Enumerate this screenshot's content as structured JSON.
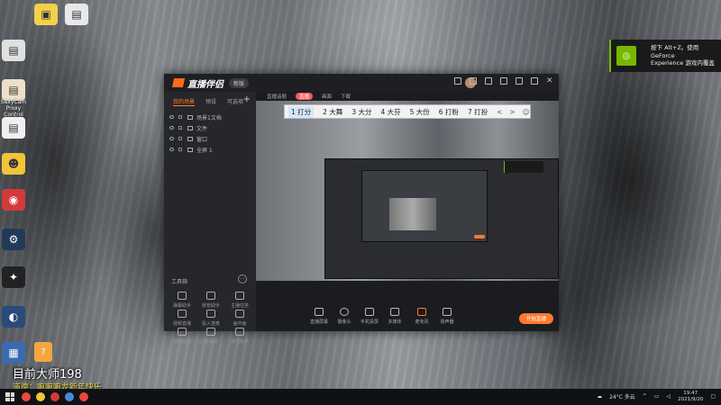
{
  "desktop": {
    "icon_labels": [
      "",
      "",
      "",
      "SexyCam Proxy Control",
      "",
      "",
      "",
      "",
      "",
      "",
      "",
      ""
    ]
  },
  "overlay": {
    "streamer_name": "目前大师198",
    "subtitle": "道德：嘛嘛嘛龙新年快乐"
  },
  "nvidia": {
    "line1": "按下 Alt+Z。使用 GeForce",
    "line2": "Experience 游戏内覆盖"
  },
  "app": {
    "brand": "直播伴侣",
    "version_badge": "新版",
    "left_tabs": [
      "我的场景",
      "预设",
      "可选项"
    ],
    "scenes": [
      {
        "label": "场景1文档"
      },
      {
        "label": "文件"
      },
      {
        "label": "窗口"
      },
      {
        "label": "全屏 1"
      }
    ],
    "toolbox_title": "工具箱",
    "tools": [
      "弹幕助手",
      "房管助手",
      "主播任务",
      "视频直播",
      "投入连麦",
      "画中画",
      "虚拟形象",
      "弹幕库",
      "歌词助手",
      "",
      "",
      ""
    ],
    "left_footer": "火热直播中话题热门榜",
    "preview_topbar": [
      "直播话题",
      "直播",
      "画面",
      "下载"
    ],
    "live_pill": "直播",
    "bottom_buttons": [
      "直播屏幕",
      "摄像头",
      "手机投屏",
      "多媒体",
      "麦克风",
      "扬声器"
    ],
    "go_live": "开始直播",
    "status": [
      "码率:0kb/s",
      "帧率:60",
      "CPU:12%",
      "内存:41%"
    ]
  },
  "ime": {
    "candidates": [
      "1 打分",
      "2 大舞",
      "3 大分",
      "4 大芬",
      "5 大份",
      "6 打粉",
      "7 打扮"
    ],
    "tail": [
      "<",
      ">"
    ]
  },
  "taskbar": {
    "weather": "24°C 多云",
    "time": "19:47",
    "date": "2021/9/20"
  }
}
